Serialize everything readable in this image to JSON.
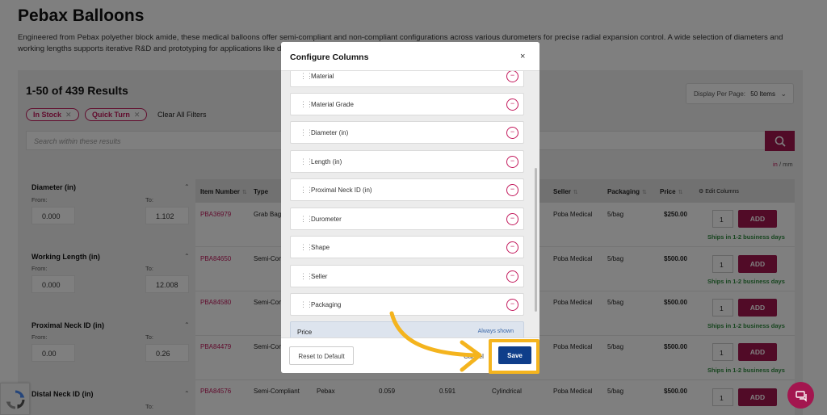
{
  "page": {
    "title": "Pebax Balloons",
    "description": "Engineered from Pebax polyether block amide, these medical balloons offer semi-compliant and non-compliant configurations across various durometers for precise radial expansion control. A wide selection of diameters and working lengths supports iterative R&D and prototyping for applications like dilation and stent deplo"
  },
  "results": {
    "count_label": "1-50 of 439 Results",
    "display_per_page_label": "Display Per Page:",
    "display_per_page_value": "50 Items"
  },
  "filters_applied": {
    "chips": [
      "In Stock",
      "Quick Turn"
    ],
    "clear_all_label": "Clear All Filters"
  },
  "search": {
    "placeholder": "Search within these results"
  },
  "units": {
    "active": "in",
    "separator": "/",
    "inactive": "mm"
  },
  "filters": [
    {
      "title": "Diameter (in)",
      "from_label": "From:",
      "to_label": "To:",
      "from": "0.000",
      "to": "1.102"
    },
    {
      "title": "Working Length (in)",
      "from_label": "From:",
      "to_label": "To:",
      "from": "0.000",
      "to": "12.008"
    },
    {
      "title": "Proximal Neck ID (in)",
      "from_label": "From:",
      "to_label": "To:",
      "from": "0.00",
      "to": "0.26"
    },
    {
      "title": "Distal Neck ID (in)",
      "from_label": "",
      "to_label": "To:",
      "from": "",
      "to": ""
    }
  ],
  "table": {
    "headers": [
      "Item Number",
      "Type",
      "Seller",
      "Packaging",
      "Price",
      "Edit Columns"
    ],
    "rows": [
      {
        "item": "PBA36979",
        "type": "Grab Bag",
        "seller": "Poba Medical",
        "packaging": "5/bag",
        "price": "$250.00",
        "qty": "1",
        "add": "ADD",
        "ships": "Ships in 1-2 business days"
      },
      {
        "item": "PBA84650",
        "type": "Semi-Com",
        "seller": "Poba Medical",
        "packaging": "5/bag",
        "price": "$500.00",
        "qty": "1",
        "add": "ADD",
        "ships": "Ships in 1-2 business days"
      },
      {
        "item": "PBA84580",
        "type": "Semi-Com",
        "seller": "Poba Medical",
        "packaging": "5/bag",
        "price": "$500.00",
        "qty": "1",
        "add": "ADD",
        "ships": "Ships in 1-2 business days"
      },
      {
        "item": "PBA84479",
        "type": "Semi-Com",
        "seller": "Poba Medical",
        "packaging": "5/bag",
        "price": "$500.00",
        "qty": "1",
        "add": "ADD",
        "ships": "Ships in 1-2 business days"
      },
      {
        "item": "PBA84576",
        "type": "Semi-Compliant",
        "material": "Pebax",
        "v1": "0.059",
        "v2": "0.591",
        "shape": "Cylindrical",
        "seller": "Poba Medical",
        "packaging": "5/bag",
        "price": "$500.00",
        "qty": "1",
        "add": "ADD",
        "ships": ""
      }
    ]
  },
  "modal": {
    "title": "Configure Columns",
    "close": "×",
    "columns": [
      "Material",
      "Material Grade",
      "Diameter (in)",
      "Length (in)",
      "Proximal Neck ID (in)",
      "Durometer",
      "Shape",
      "Seller",
      "Packaging"
    ],
    "remove_symbol": "−",
    "fixed_column": {
      "name": "Price",
      "note": "Always shown"
    },
    "reset_label": "Reset to Default",
    "cancel_label": "Cancel",
    "save_label": "Save"
  },
  "icons": {
    "search": "search-icon",
    "chat": "chat-icon",
    "captcha": "recaptcha-icon",
    "arrow": "tutorial-arrow"
  },
  "colors": {
    "brand": "#a3164f",
    "save": "#0f3e8a",
    "highlight": "#f4b41e",
    "ships": "#2e8b3e"
  }
}
